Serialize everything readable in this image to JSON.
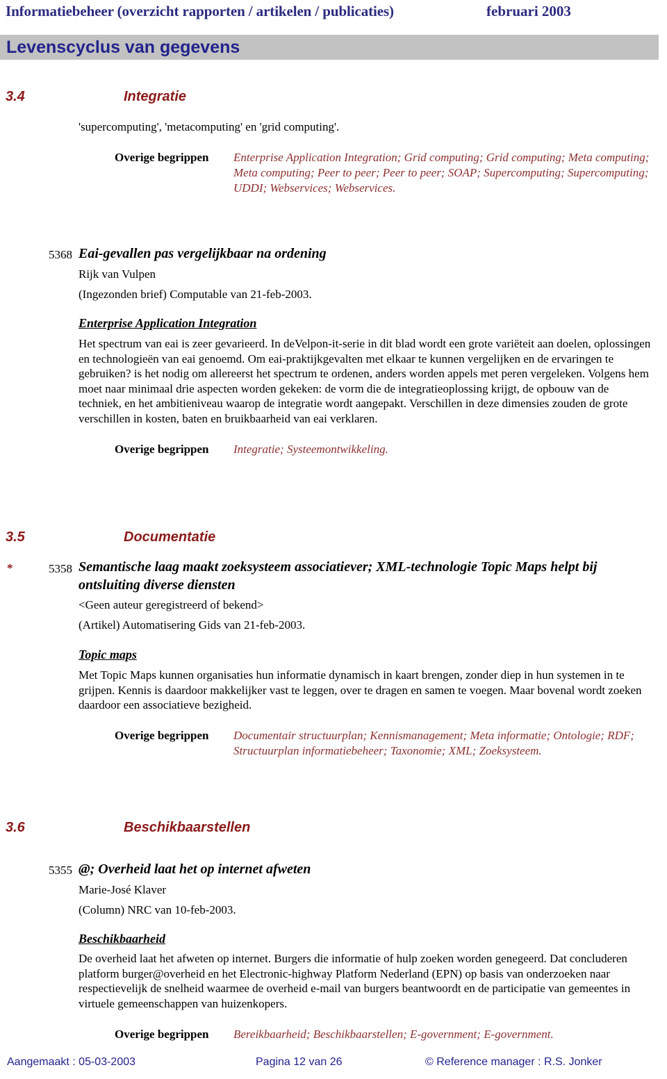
{
  "header": {
    "doc_title": "Informatiebeheer (overzicht  rapporten / artikelen / publicaties)",
    "period": "februari 2003"
  },
  "banner": {
    "title": "Levenscyclus van gegevens"
  },
  "sections": [
    {
      "number": "3.4",
      "name": "Integratie",
      "intro_line": "'supercomputing', 'metacomputing' en 'grid computing'.",
      "overige_begrippen_label": "Overige begrippen",
      "overige_begrippen_value": "Enterprise Application Integration; Grid computing; Grid computing; Meta computing; Meta computing; Peer to peer; Peer to peer; SOAP; Supercomputing; Supercomputing; UDDI; Webservices; Webservices."
    },
    {
      "number": "3.5",
      "name": "Documentatie"
    },
    {
      "number": "3.6",
      "name": "Beschikbaarstellen"
    }
  ],
  "entries": [
    {
      "marker": "",
      "id": "5368",
      "title": "Eai-gevallen pas vergelijkbaar na ordening",
      "author": "Rijk van Vulpen",
      "source": "(Ingezonden brief)   Computable van 21-feb-2003.",
      "subject": "Enterprise Application Integration",
      "body": "Het spectrum van eai is zeer gevarieerd. In deVelpon-it-serie in dit blad wordt een grote variëteit aan doelen, oplossingen en technologieën van eai genoemd. Om eai-praktijkgevalten met elkaar te kunnen vergelijken en de ervaringen te gebruiken? is het nodig om allereerst het spectrum te ordenen, anders worden appels met peren vergeleken. Volgens hem moet naar minimaal drie aspecten worden gekeken: de vorm die de integratieoplossing krijgt, de opbouw van de techniek, en het ambitieniveau waarop de integratie wordt aangepakt. Verschillen in deze dimensies zouden de grote verschillen in kosten, baten en bruikbaarheid van eai verklaren.",
      "overige_begrippen_label": "Overige begrippen",
      "overige_begrippen_value": "Integratie; Systeemontwikkeling."
    },
    {
      "marker": "*",
      "id": "5358",
      "title": "Semantische laag maakt zoeksysteem associatiever; XML-technologie Topic Maps helpt bij ontsluiting diverse diensten",
      "author": "<Geen auteur geregistreerd of bekend>",
      "source": "(Artikel)   Automatisering Gids van 21-feb-2003.",
      "subject": "Topic maps",
      "body": "Met Topic Maps kunnen organisaties hun informatie dynamisch in kaart brengen, zonder diep in hun systemen in te grijpen. Kennis is daardoor makkelijker vast te leggen, over te dragen en samen te voegen. Maar bovenal wordt zoeken daardoor een associatieve bezigheid.",
      "overige_begrippen_label": "Overige begrippen",
      "overige_begrippen_value": "Documentair structuurplan; Kennismanagement; Meta informatie; Ontologie; RDF; Structuurplan informatiebeheer; Taxonomie; XML; Zoeksysteem."
    },
    {
      "marker": "",
      "id": "5355",
      "title": "@; Overheid laat het op internet afweten",
      "author": "Marie-José Klaver",
      "source": "(Column)   NRC van 10-feb-2003.",
      "subject": "Beschikbaarheid",
      "body": "De overheid laat het afweten op internet. Burgers die informatie of hulp zoeken worden genegeerd. Dat concluderen platform burger@overheid en het Electronic-highway Platform Nederland (EPN) op basis van onderzoeken naar respectievelijk de snelheid waarmee de overheid e-mail van burgers beantwoordt en de participatie van gemeentes in virtuele gemeenschappen van huizenkopers.",
      "overige_begrippen_label": "Overige begrippen",
      "overige_begrippen_value": "Bereikbaarheid; Beschikbaarstellen; E-government; E-government."
    }
  ],
  "footer": {
    "created": "Aangemaakt : 05-03-2003",
    "page": "Pagina 12 van  26",
    "copyright": "© Reference manager : R.S. Jonker"
  },
  "colors": {
    "header_blue": "#2b2b80",
    "banner_gray": "#c2c2c2",
    "section_red": "#8c1a1a",
    "term_red": "#8c3030",
    "footer_blue": "#23238c"
  }
}
